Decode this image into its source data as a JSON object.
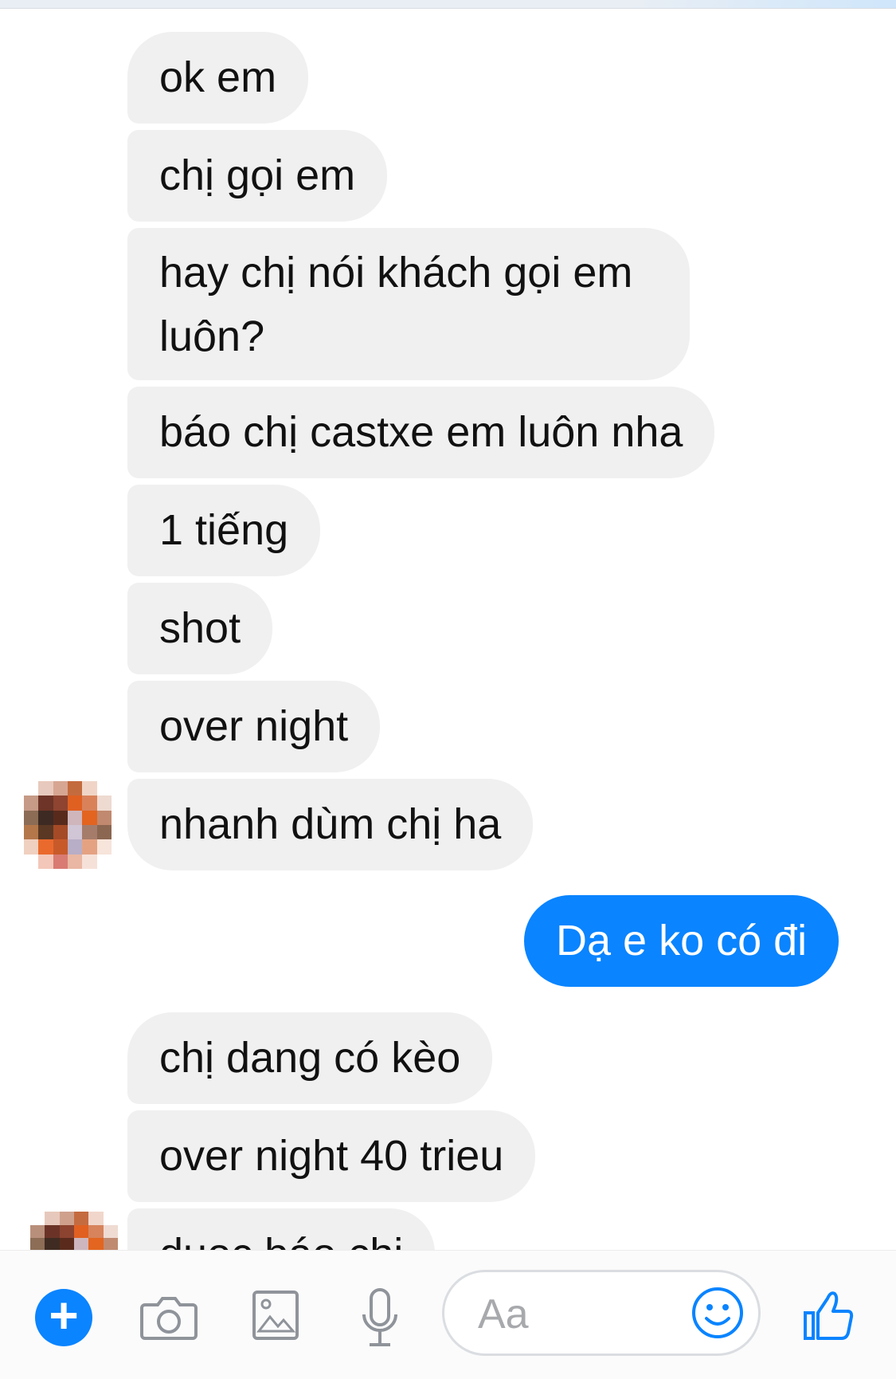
{
  "conversation": {
    "messages": [
      {
        "from": "contact",
        "text": "ok em"
      },
      {
        "from": "contact",
        "text": "chị gọi em"
      },
      {
        "from": "contact",
        "text": "hay chị nói khách gọi em luôn?"
      },
      {
        "from": "contact",
        "text": "báo chị castxe em luôn nha"
      },
      {
        "from": "contact",
        "text": "1 tiếng"
      },
      {
        "from": "contact",
        "text": "shot"
      },
      {
        "from": "contact",
        "text": "over night"
      },
      {
        "from": "contact",
        "text": "nhanh dùm chị ha"
      },
      {
        "from": "me",
        "text": "Dạ e ko có đi"
      },
      {
        "from": "contact",
        "text": "chị dang có kèo"
      },
      {
        "from": "contact",
        "text": "over night 40 trieu"
      },
      {
        "from": "contact",
        "text": "duoc báo chi"
      }
    ]
  },
  "composer": {
    "placeholder": "Aa",
    "icons": [
      "plus-icon",
      "camera-icon",
      "photo-icon",
      "microphone-icon",
      "emoji-icon",
      "thumbs-up-icon"
    ]
  },
  "colors": {
    "outgoing_bubble": "#0a84ff",
    "incoming_bubble": "#f0f0f0",
    "accent": "#0a84ff"
  }
}
